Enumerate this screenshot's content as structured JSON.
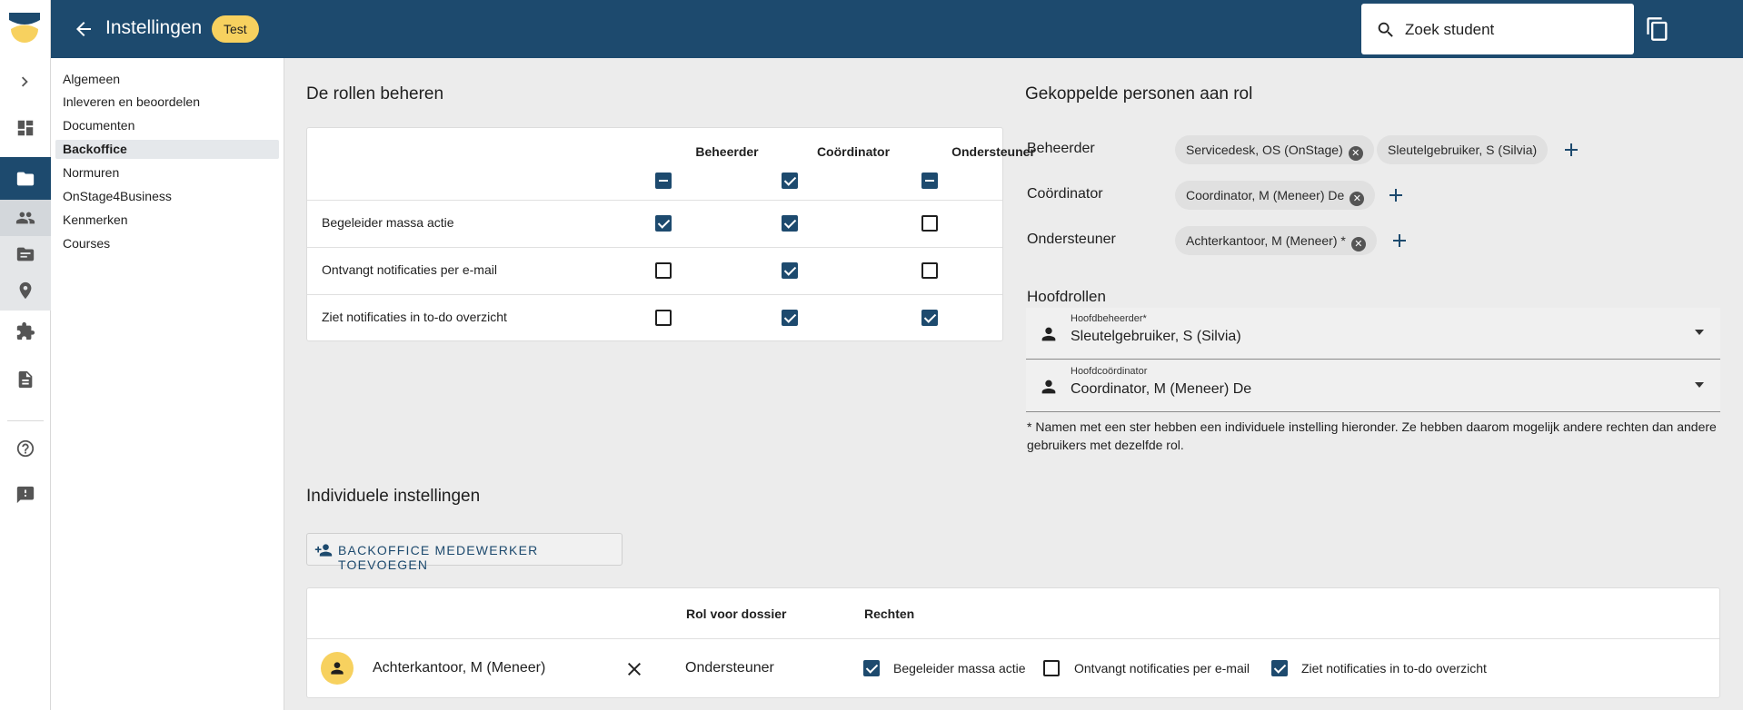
{
  "header": {
    "title": "Instellingen",
    "badge": "Test",
    "search_placeholder": "Zoek student"
  },
  "settings_nav": {
    "items": [
      {
        "label": "Algemeen",
        "active": false
      },
      {
        "label": "Inleveren en beoordelen",
        "active": false
      },
      {
        "label": "Documenten",
        "active": false
      },
      {
        "label": "Backoffice",
        "active": true
      },
      {
        "label": "Normuren",
        "active": false
      },
      {
        "label": "OnStage4Business",
        "active": false
      },
      {
        "label": "Kenmerken",
        "active": false
      },
      {
        "label": "Courses",
        "active": false
      }
    ]
  },
  "roles": {
    "title": "De rollen beheren",
    "columns": [
      "Beheerder",
      "Coördinator",
      "Ondersteuner"
    ],
    "header_state": [
      "indeterminate",
      "checked",
      "indeterminate"
    ],
    "rows": [
      {
        "label": "Begeleider massa actie",
        "values": [
          true,
          true,
          false
        ]
      },
      {
        "label": "Ontvangt notificaties per e-mail",
        "values": [
          false,
          true,
          false
        ]
      },
      {
        "label": "Ziet notificaties in to-do overzicht",
        "values": [
          false,
          true,
          true
        ]
      }
    ]
  },
  "linked": {
    "title": "Gekoppelde personen aan rol",
    "groups": [
      {
        "role": "Beheerder",
        "people": [
          "Servicedesk, OS (OnStage)",
          "Sleutelgebruiker, S (Silvia)"
        ]
      },
      {
        "role": "Coördinator",
        "people": [
          "Coordinator, M (Meneer) De"
        ]
      },
      {
        "role": "Ondersteuner",
        "people": [
          "Achterkantoor, M (Meneer) *"
        ]
      }
    ]
  },
  "main_roles": {
    "title": "Hoofdrollen",
    "head_admin_label": "Hoofdbeheerder*",
    "head_admin_value": "Sleutelgebruiker, S (Silvia)",
    "head_coord_label": "Hoofdcoördinator",
    "head_coord_value": "Coordinator, M (Meneer) De",
    "note": "* Namen met een ster hebben een individuele instelling hieronder. Ze hebben daarom mogelijk andere rechten dan andere gebruikers met dezelfde rol."
  },
  "individual": {
    "title": "Individuele instellingen",
    "add_button": "BACKOFFICE MEDEWERKER TOEVOEGEN",
    "col_role": "Rol voor dossier",
    "col_rights": "Rechten",
    "rows": [
      {
        "name": "Achterkantoor, M (Meneer)",
        "role": "Ondersteuner",
        "rights": [
          {
            "label": "Begeleider massa actie",
            "checked": true
          },
          {
            "label": "Ontvangt notificaties per e-mail",
            "checked": false
          },
          {
            "label": "Ziet notificaties in to-do overzicht",
            "checked": true
          }
        ]
      }
    ]
  },
  "colors": {
    "primary": "#1d4a6e",
    "badge": "#f7d15f",
    "background": "#ececec"
  },
  "rail_icons": [
    "chevron-right-icon",
    "dashboard-icon",
    "folder-icon",
    "people-icon",
    "folder-list-icon",
    "location-icon",
    "puzzle-icon",
    "document-icon",
    "help-icon",
    "feedback-icon"
  ]
}
